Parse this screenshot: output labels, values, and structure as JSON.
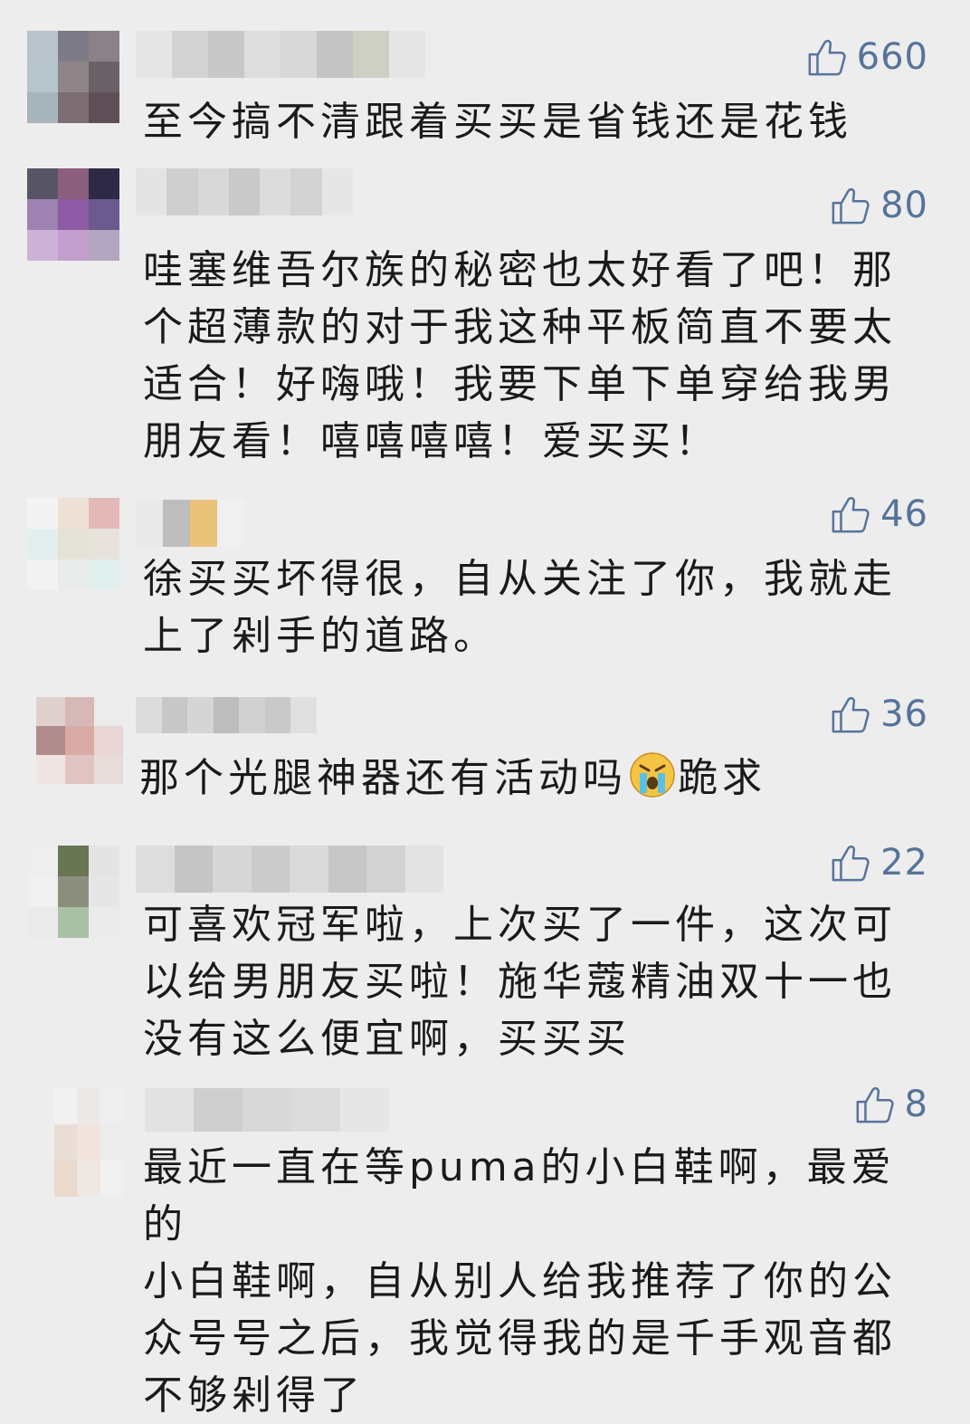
{
  "comments": [
    {
      "likes": "660",
      "text": "至今搞不清跟着买买是省钱还是花钱",
      "avatar": [
        "#b9c3cc",
        "#7d7c86",
        "#8a8189",
        "#b6c4cc",
        "#8f8589",
        "#6a6068",
        "#a8b4bc",
        "#7b6d72",
        "#5d4f55"
      ],
      "name": [
        "#e6e6e6",
        "#d2d2d2",
        "#c8c8c8",
        "#dddddd",
        "#d8d8d8",
        "#c4c4c4",
        "#cdd0c2",
        "#e5e5e5"
      ]
    },
    {
      "likes": "80",
      "text": "哇塞维吾尔族的秘密也太好看了吧！那\n个超薄款的对于我这种平板简直不要太\n适合！好嗨哦！我要下单下单穿给我男\n朋友看！嘻嘻嘻嘻！爱买买！",
      "avatar": [
        "#575466",
        "#8c5e7e",
        "#2e2a46",
        "#9d82b2",
        "#8d5aa5",
        "#6a5a8d",
        "#cdb2d8",
        "#c19fcc",
        "#b3a6c0"
      ],
      "name": [
        "#e4e4e4",
        "#cfcfcf",
        "#d8d8d8",
        "#c9c9c9",
        "#dcdcdc",
        "#d3d3d3",
        "#e6e6e6"
      ]
    },
    {
      "likes": "46",
      "text": "徐买买坏得很，自从关注了你，我就走\n上了剁手的道路。",
      "avatar": [
        "#f3f3f3",
        "#ede1d6",
        "#e4b8b8",
        "#e3eeee",
        "#e4e2d6",
        "#e7e3dc",
        "#f2f2f2",
        "#e9eaea",
        "#e1eeee"
      ],
      "name": [
        "#e9e9e9",
        "#bdbdbd",
        "#eac27a",
        "#f0f0f0"
      ]
    },
    {
      "likes": "36",
      "text": "那个光腿神器还有活动吗",
      "text_after": "跪求",
      "avatar": [
        "#ddd0cd",
        "#d6b9b6",
        "#ececec",
        "#b18c8c",
        "#d9aaa6",
        "#e8d6d4",
        "#efe4e2",
        "#e0c4c2",
        "#e8dcdb"
      ],
      "name": [
        "#dcdcdc",
        "#c7c7c7",
        "#d5d5d5",
        "#bdbdbd",
        "#d0d0d0",
        "#c9c9c9",
        "#e0e0e0"
      ]
    },
    {
      "likes": "22",
      "text": "可喜欢冠军啦，上次买了一件，这次可\n以给男朋友买啦！施华蔻精油双十一也\n没有这么便宜啊，买买买",
      "avatar": [
        "#eeeeee",
        "#6a7653",
        "#e4e4e4",
        "#f0f0f0",
        "#8c8f7e",
        "#e6e6e6",
        "#eaeaea",
        "#a9c2a6",
        "#ebebeb"
      ],
      "name": [
        "#dddddd",
        "#c5c5c5",
        "#d6d6d6",
        "#cbcbcb",
        "#dadada",
        "#c7c7c7",
        "#d2d2d2",
        "#e3e3e3"
      ]
    },
    {
      "likes": "8",
      "text": "最近一直在等puma的小白鞋啊，最爱的\n小白鞋啊，自从别人给我推荐了你的公\n众号号之后，我觉得我的是千手观音都\n不够剁得了",
      "avatar": [
        "#f1f1f1",
        "#ece8e6",
        "#efefef",
        "#e9ddd6",
        "#f1e3de",
        "#ececec",
        "#ead9cc",
        "#efe7e2",
        "#f0f0f0"
      ],
      "name": [
        "#e2e2e2",
        "#cecece",
        "#d8d8d8",
        "#dcdcdc",
        "#e6e6e6"
      ]
    }
  ]
}
